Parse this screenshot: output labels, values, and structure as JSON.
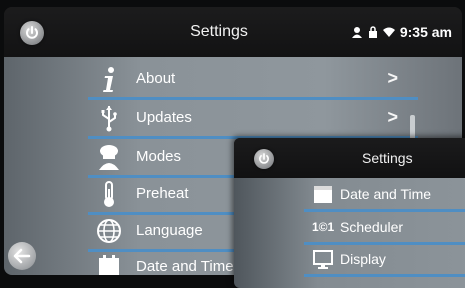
{
  "main": {
    "title": "Settings",
    "status_time": "9:35 am",
    "menu": [
      {
        "label": "About",
        "icon": "info-icon",
        "chevron": ">"
      },
      {
        "label": "Updates",
        "icon": "usb-icon",
        "chevron": ">"
      },
      {
        "label": "Modes",
        "icon": "chef-icon"
      },
      {
        "label": "Preheat",
        "icon": "thermometer-icon"
      },
      {
        "label": "Language",
        "icon": "globe-icon"
      },
      {
        "label": "Date and Time",
        "icon": "calendar-icon"
      }
    ]
  },
  "front": {
    "title": "Settings",
    "menu": [
      {
        "label": "Date and Time",
        "icon": "calendar-icon"
      },
      {
        "label": "Scheduler",
        "icon": "scheduler-icon",
        "icon_text": "1©1"
      },
      {
        "label": "Display",
        "icon": "monitor-icon"
      }
    ]
  },
  "colors": {
    "accent_divider": "#4f8ec3",
    "list_background": "#8f979d",
    "topbar": "#121213"
  }
}
